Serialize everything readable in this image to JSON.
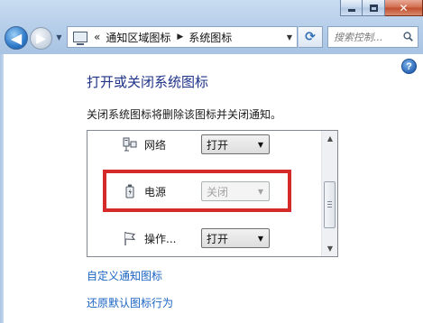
{
  "window": {
    "close_glyph": "✕",
    "accent_color": "#1e3287",
    "link_color": "#1b64c2",
    "highlight_color": "#d42a2a"
  },
  "navigation": {
    "back_glyph": "◀",
    "forward_glyph": "▶",
    "history_glyph": "▼",
    "history_separator": "«",
    "breadcrumbs": [
      "通知区域图标",
      "系统图标"
    ],
    "breadcrumb_arrow": "▶",
    "dropdown_glyph": "▼",
    "refresh_glyph": "⟳"
  },
  "search": {
    "placeholder": "搜索控制..."
  },
  "help": {
    "glyph": "?"
  },
  "main": {
    "title": "打开或关闭系统图标",
    "description": "关闭系统图标将删除该图标并关闭通知。",
    "rows": [
      {
        "label": "网络",
        "value": "打开",
        "icon": "network-icon",
        "disabled": false
      },
      {
        "label": "电源",
        "value": "关闭",
        "icon": "power-icon",
        "disabled": true
      },
      {
        "label": "操作...",
        "value": "打开",
        "icon": "flag-icon",
        "disabled": false
      }
    ],
    "select_arrow": "▼",
    "links": {
      "customize": "自定义通知图标",
      "restore": "还原默认图标行为"
    }
  },
  "scrollbar": {
    "up_glyph": "▲",
    "down_glyph": "▼"
  }
}
